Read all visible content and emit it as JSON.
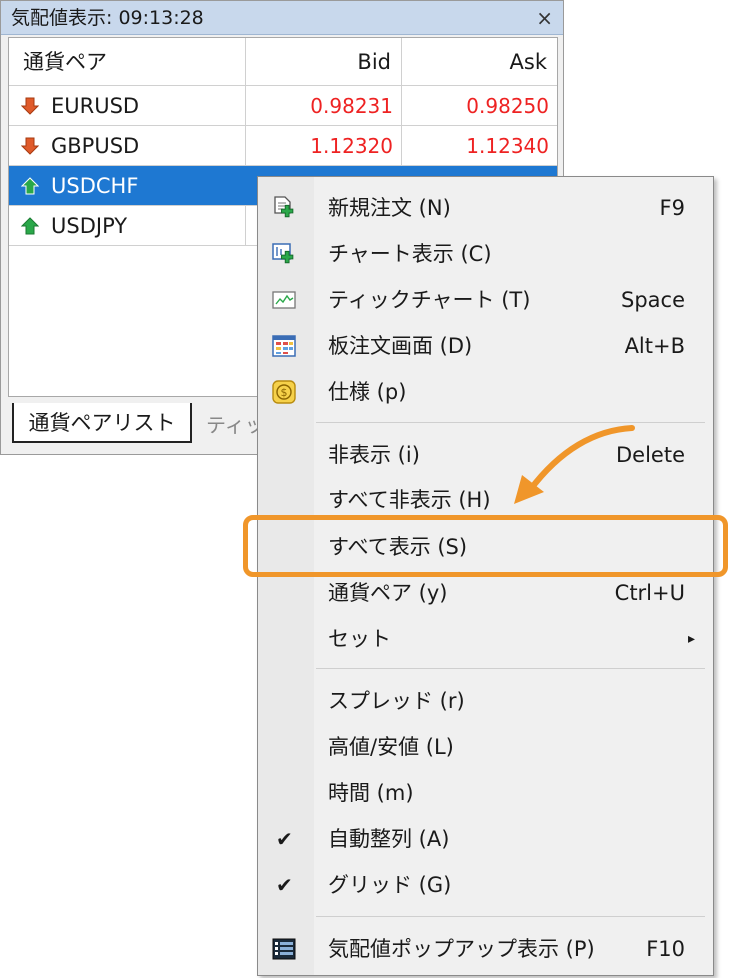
{
  "window": {
    "title": "気配値表示: 09:13:28",
    "close_glyph": "×"
  },
  "table": {
    "headers": {
      "symbol": "通貨ペア",
      "bid": "Bid",
      "ask": "Ask"
    },
    "rows": [
      {
        "symbol": "EURUSD",
        "bid": "0.98231",
        "ask": "0.98250",
        "direction": "down"
      },
      {
        "symbol": "GBPUSD",
        "bid": "1.12320",
        "ask": "1.12340",
        "direction": "down"
      },
      {
        "symbol": "USDCHF",
        "bid": "",
        "ask": "",
        "direction": "up",
        "selected": true
      },
      {
        "symbol": "USDJPY",
        "bid": "",
        "ask": "",
        "direction": "up"
      }
    ]
  },
  "tabs": {
    "active": "通貨ペアリスト",
    "inactive": "ティッ"
  },
  "menu": {
    "items": [
      {
        "label": "新規注文 (N)",
        "shortcut": "F9",
        "icon": "new-order-icon"
      },
      {
        "label": "チャート表示 (C)",
        "shortcut": "",
        "icon": "chart-window-icon"
      },
      {
        "label": "ティックチャート (T)",
        "shortcut": "Space",
        "icon": "tick-chart-icon"
      },
      {
        "label": "板注文画面 (D)",
        "shortcut": "Alt+B",
        "icon": "depth-of-market-icon"
      },
      {
        "label": "仕様 (p)",
        "shortcut": "",
        "icon": "specification-icon"
      },
      {
        "label": "非表示 (i)",
        "shortcut": "Delete"
      },
      {
        "label": "すべて非表示 (H)",
        "shortcut": ""
      },
      {
        "label": "すべて表示 (S)",
        "shortcut": "",
        "highlighted": true
      },
      {
        "label": "通貨ペア (y)",
        "shortcut": "Ctrl+U"
      },
      {
        "label": "セット",
        "shortcut": "",
        "submenu": "▸"
      },
      {
        "label": "スプレッド (r)",
        "shortcut": ""
      },
      {
        "label": "高値/安値 (L)",
        "shortcut": ""
      },
      {
        "label": "時間 (m)",
        "shortcut": ""
      },
      {
        "label": "自動整列 (A)",
        "shortcut": "",
        "checked": "✔"
      },
      {
        "label": "グリッド (G)",
        "shortcut": "",
        "checked": "✔"
      },
      {
        "label": "気配値ポップアップ表示 (P)",
        "shortcut": "F10",
        "icon": "popup-prices-icon"
      }
    ]
  },
  "colors": {
    "price_red": "#ee2222",
    "selection_blue": "#1e78d2",
    "highlight_orange": "#f0962a",
    "arrow_down": "#e05a2a",
    "arrow_up": "#2aa84a"
  }
}
